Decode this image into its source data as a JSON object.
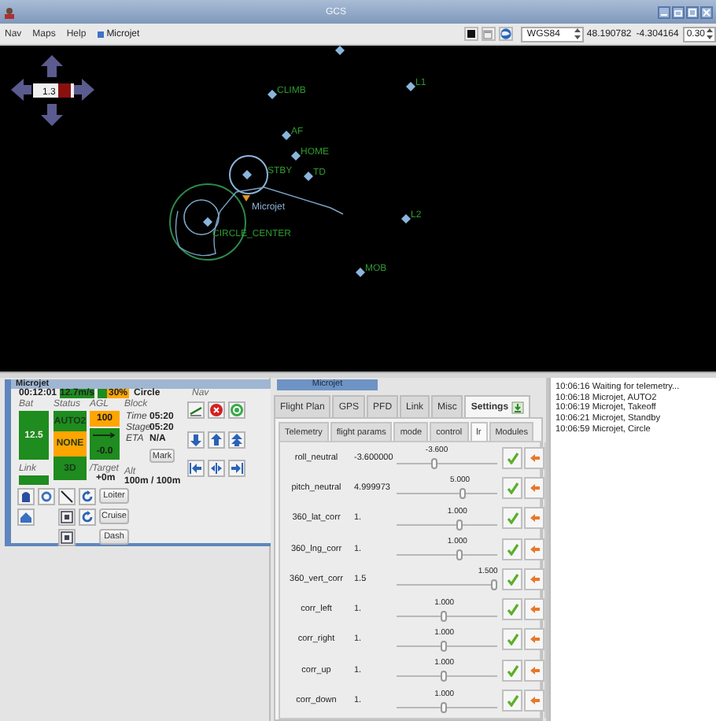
{
  "window": {
    "title": "GCS"
  },
  "menu": [
    {
      "label": "Nav"
    },
    {
      "label": "Maps"
    },
    {
      "label": "Help"
    }
  ],
  "aircraft": {
    "label": "Microjet"
  },
  "toolbar": {
    "projection": "WGS84",
    "latitude": "48.190782",
    "longitude": "-4.304164",
    "step": "0.30"
  },
  "map": {
    "zoom": "1.3",
    "aircraft_label": "Microjet",
    "waypoints": [
      {
        "kind": "waypoint"
      },
      {
        "kind": "waypoint",
        "name": "CLIMB"
      },
      {
        "kind": "waypoint",
        "name": "L1"
      },
      {
        "kind": "waypoint",
        "name": "AF"
      },
      {
        "kind": "waypoint",
        "name": "HOME"
      },
      {
        "kind": "waypoint",
        "name": "STBY"
      },
      {
        "kind": "waypoint",
        "name": "TD"
      },
      {
        "kind": "waypoint",
        "name": "CIRCLE_CENTER"
      },
      {
        "kind": "waypoint",
        "name": "L2"
      },
      {
        "kind": "waypoint",
        "name": "MOB"
      }
    ]
  },
  "strip": {
    "title": "Microjet",
    "flight_time": "00:12:01",
    "speed": "12.7m/s",
    "throttle": {
      "reading": "30%",
      "level": 0.3
    },
    "mode": "Circle",
    "nav_label": "Nav",
    "bat": {
      "label": "Bat",
      "value": "12.5"
    },
    "status": {
      "label": "Status",
      "cells": [
        {
          "text": "AUTO2",
          "color": "#1e8c1e"
        },
        {
          "text": "NONE",
          "color": "#ffa500"
        },
        {
          "text": "3D",
          "color": "#1e8c1e"
        }
      ]
    },
    "agl": {
      "label": "AGL",
      "cells": [
        {
          "kind": "text",
          "text": "100",
          "color": "#ffa500"
        },
        {
          "kind": "arrow",
          "color": "#1e8c1e"
        },
        {
          "kind": "text",
          "text": "-0.0",
          "color": "#1e8c1e"
        }
      ]
    },
    "block": {
      "label": "Block",
      "rows": [
        {
          "label": "Time",
          "value": "05:20"
        },
        {
          "label": "Stage",
          "value": "05:20"
        },
        {
          "label": "ETA",
          "value": "N/A"
        }
      ]
    },
    "mark": "Mark",
    "link": {
      "label": "Link"
    },
    "target": {
      "label": "/Target",
      "value": "+0m"
    },
    "alt": {
      "label": "Alt",
      "value": "100m / 100m"
    },
    "buttons": [
      "Loiter",
      "Cruise",
      "Dash"
    ]
  },
  "settings": {
    "header": "Microjet",
    "tabs": [
      {
        "label": "Flight Plan",
        "selected": false
      },
      {
        "label": "GPS",
        "selected": false
      },
      {
        "label": "PFD",
        "selected": false
      },
      {
        "label": "Link",
        "selected": false
      },
      {
        "label": "Misc",
        "selected": false
      },
      {
        "label": "Settings",
        "selected": true
      }
    ],
    "subtabs": [
      {
        "label": "Telemetry",
        "selected": false
      },
      {
        "label": "flight params",
        "selected": false
      },
      {
        "label": "mode",
        "selected": false
      },
      {
        "label": "control",
        "selected": false
      },
      {
        "label": "lr",
        "selected": true
      },
      {
        "label": "Modules",
        "selected": false
      }
    ],
    "rows": [
      {
        "name": "roll_neutral",
        "value": "-3.600000",
        "reading": "-3.600",
        "level": 0.38
      },
      {
        "name": "pitch_neutral",
        "value": "4.999973",
        "reading": "5.000",
        "level": 0.65
      },
      {
        "name": "360_lat_corr",
        "value": "1.",
        "reading": "1.000",
        "level": 0.62
      },
      {
        "name": "360_lng_corr",
        "value": "1.",
        "reading": "1.000",
        "level": 0.62
      },
      {
        "name": "360_vert_corr",
        "value": "1.5",
        "reading": "1.500",
        "level": 0.97
      },
      {
        "name": "corr_left",
        "value": "1.",
        "reading": "1.000",
        "level": 0.47
      },
      {
        "name": "corr_right",
        "value": "1.",
        "reading": "1.000",
        "level": 0.47
      },
      {
        "name": "corr_up",
        "value": "1.",
        "reading": "1.000",
        "level": 0.47
      },
      {
        "name": "corr_down",
        "value": "1.",
        "reading": "1.000",
        "level": 0.47
      }
    ]
  },
  "log": {
    "lines": [
      "10:06:16 Waiting for telemetry...",
      "10:06:18 Microjet, AUTO2",
      "10:06:19 Microjet, Takeoff",
      "10:06:21 Microjet, Standby",
      "10:06:59 Microjet, Circle"
    ]
  }
}
